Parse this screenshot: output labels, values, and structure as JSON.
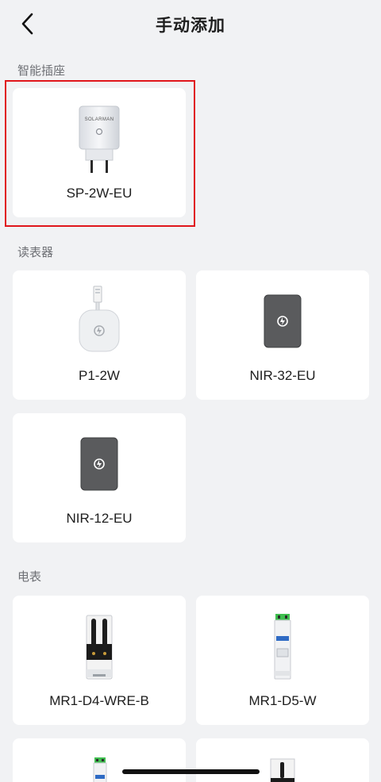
{
  "header": {
    "title": "手动添加"
  },
  "sections": {
    "smart_socket": {
      "label": "智能插座"
    },
    "meter_reader": {
      "label": "读表器"
    },
    "electric_meter": {
      "label": "电表"
    }
  },
  "devices": {
    "sp2w": {
      "name": "SP-2W-EU",
      "brand": "SOLARMAN"
    },
    "p1": {
      "name": "P1-2W"
    },
    "nir32": {
      "name": "NIR-32-EU"
    },
    "nir12": {
      "name": "NIR-12-EU"
    },
    "mr1d4": {
      "name": "MR1-D4-WRE-B"
    },
    "mr1d5": {
      "name": "MR1-D5-W"
    }
  },
  "colors": {
    "background": "#f1f2f4",
    "card": "#ffffff",
    "highlight": "#e0161b"
  }
}
